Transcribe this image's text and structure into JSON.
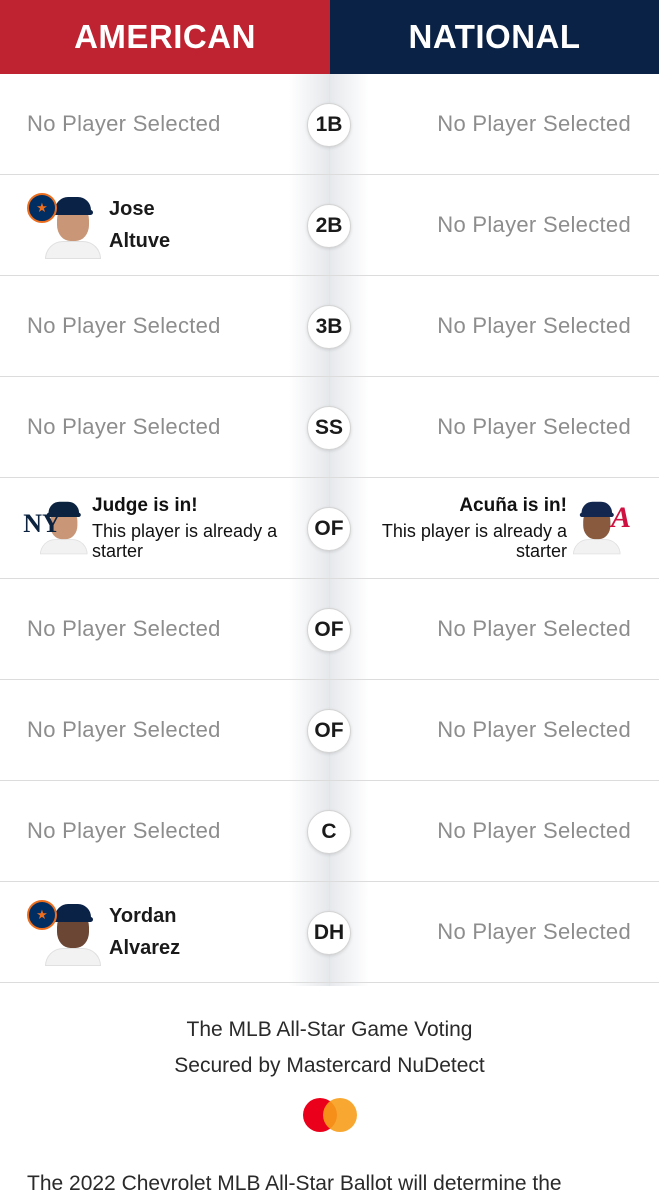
{
  "header": {
    "american_label": "AMERICAN",
    "national_label": "NATIONAL"
  },
  "colors": {
    "american": "#bf2230",
    "national": "#0b2247",
    "empty_text": "#8d8d8d"
  },
  "empty_label": "No Player Selected",
  "rows": [
    {
      "position": "1B",
      "american": {
        "type": "empty",
        "text": "No Player Selected"
      },
      "national": {
        "type": "empty",
        "text": "No Player Selected"
      }
    },
    {
      "position": "2B",
      "american": {
        "type": "player",
        "first": "Jose",
        "last": "Altuve",
        "team_icon": "astros-logo-icon"
      },
      "national": {
        "type": "empty",
        "text": "No Player Selected"
      }
    },
    {
      "position": "3B",
      "american": {
        "type": "empty",
        "text": "No Player Selected"
      },
      "national": {
        "type": "empty",
        "text": "No Player Selected"
      }
    },
    {
      "position": "SS",
      "american": {
        "type": "empty",
        "text": "No Player Selected"
      },
      "national": {
        "type": "empty",
        "text": "No Player Selected"
      }
    },
    {
      "position": "OF",
      "american": {
        "type": "starter",
        "title": "Judge is in!",
        "text": "This player is already a starter",
        "team_icon": "yankees-logo-icon"
      },
      "national": {
        "type": "starter",
        "title": "Acuña is in!",
        "text": "This player is already a starter",
        "team_icon": "braves-logo-icon"
      }
    },
    {
      "position": "OF",
      "american": {
        "type": "empty",
        "text": "No Player Selected"
      },
      "national": {
        "type": "empty",
        "text": "No Player Selected"
      }
    },
    {
      "position": "OF",
      "american": {
        "type": "empty",
        "text": "No Player Selected"
      },
      "national": {
        "type": "empty",
        "text": "No Player Selected"
      }
    },
    {
      "position": "C",
      "american": {
        "type": "empty",
        "text": "No Player Selected"
      },
      "national": {
        "type": "empty",
        "text": "No Player Selected"
      }
    },
    {
      "position": "DH",
      "american": {
        "type": "player",
        "first": "Yordan",
        "last": "Alvarez",
        "team_icon": "astros-logo-icon"
      },
      "national": {
        "type": "empty",
        "text": "No Player Selected"
      }
    }
  ],
  "footer": {
    "secured_line1": "The MLB All-Star Game Voting",
    "secured_line2": "Secured by Mastercard NuDetect",
    "logo_icon": "mastercard-logo-icon",
    "disclaimer": "The 2022 Chevrolet MLB All-Star Ballot will determine the"
  }
}
